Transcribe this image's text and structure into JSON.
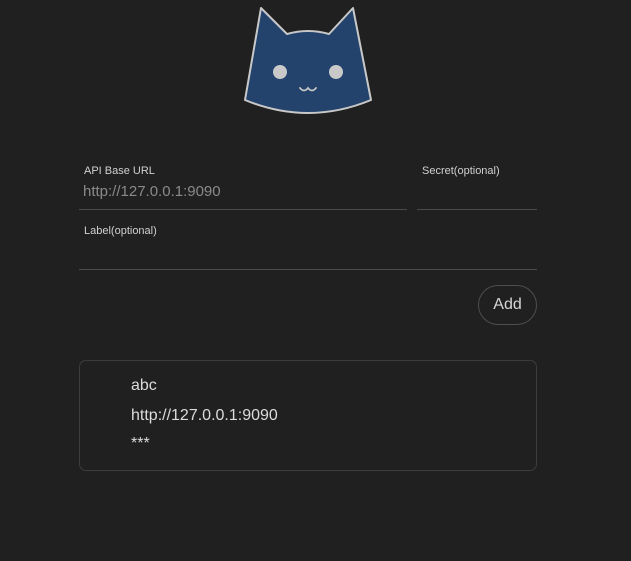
{
  "logo": {
    "icon": "cat-face-icon",
    "fill_color": "#2b4a73",
    "outline_color": "#c8c8c8"
  },
  "form": {
    "api_base_url": {
      "label": "API Base URL",
      "placeholder": "http://127.0.0.1:9090",
      "value": ""
    },
    "secret": {
      "label": "Secret(optional)",
      "placeholder": "",
      "value": ""
    },
    "label": {
      "label": "Label(optional)",
      "placeholder": "",
      "value": ""
    },
    "add_label": "Add"
  },
  "backends": [
    {
      "label": "abc",
      "url": "http://127.0.0.1:9090",
      "secret": "***"
    }
  ]
}
